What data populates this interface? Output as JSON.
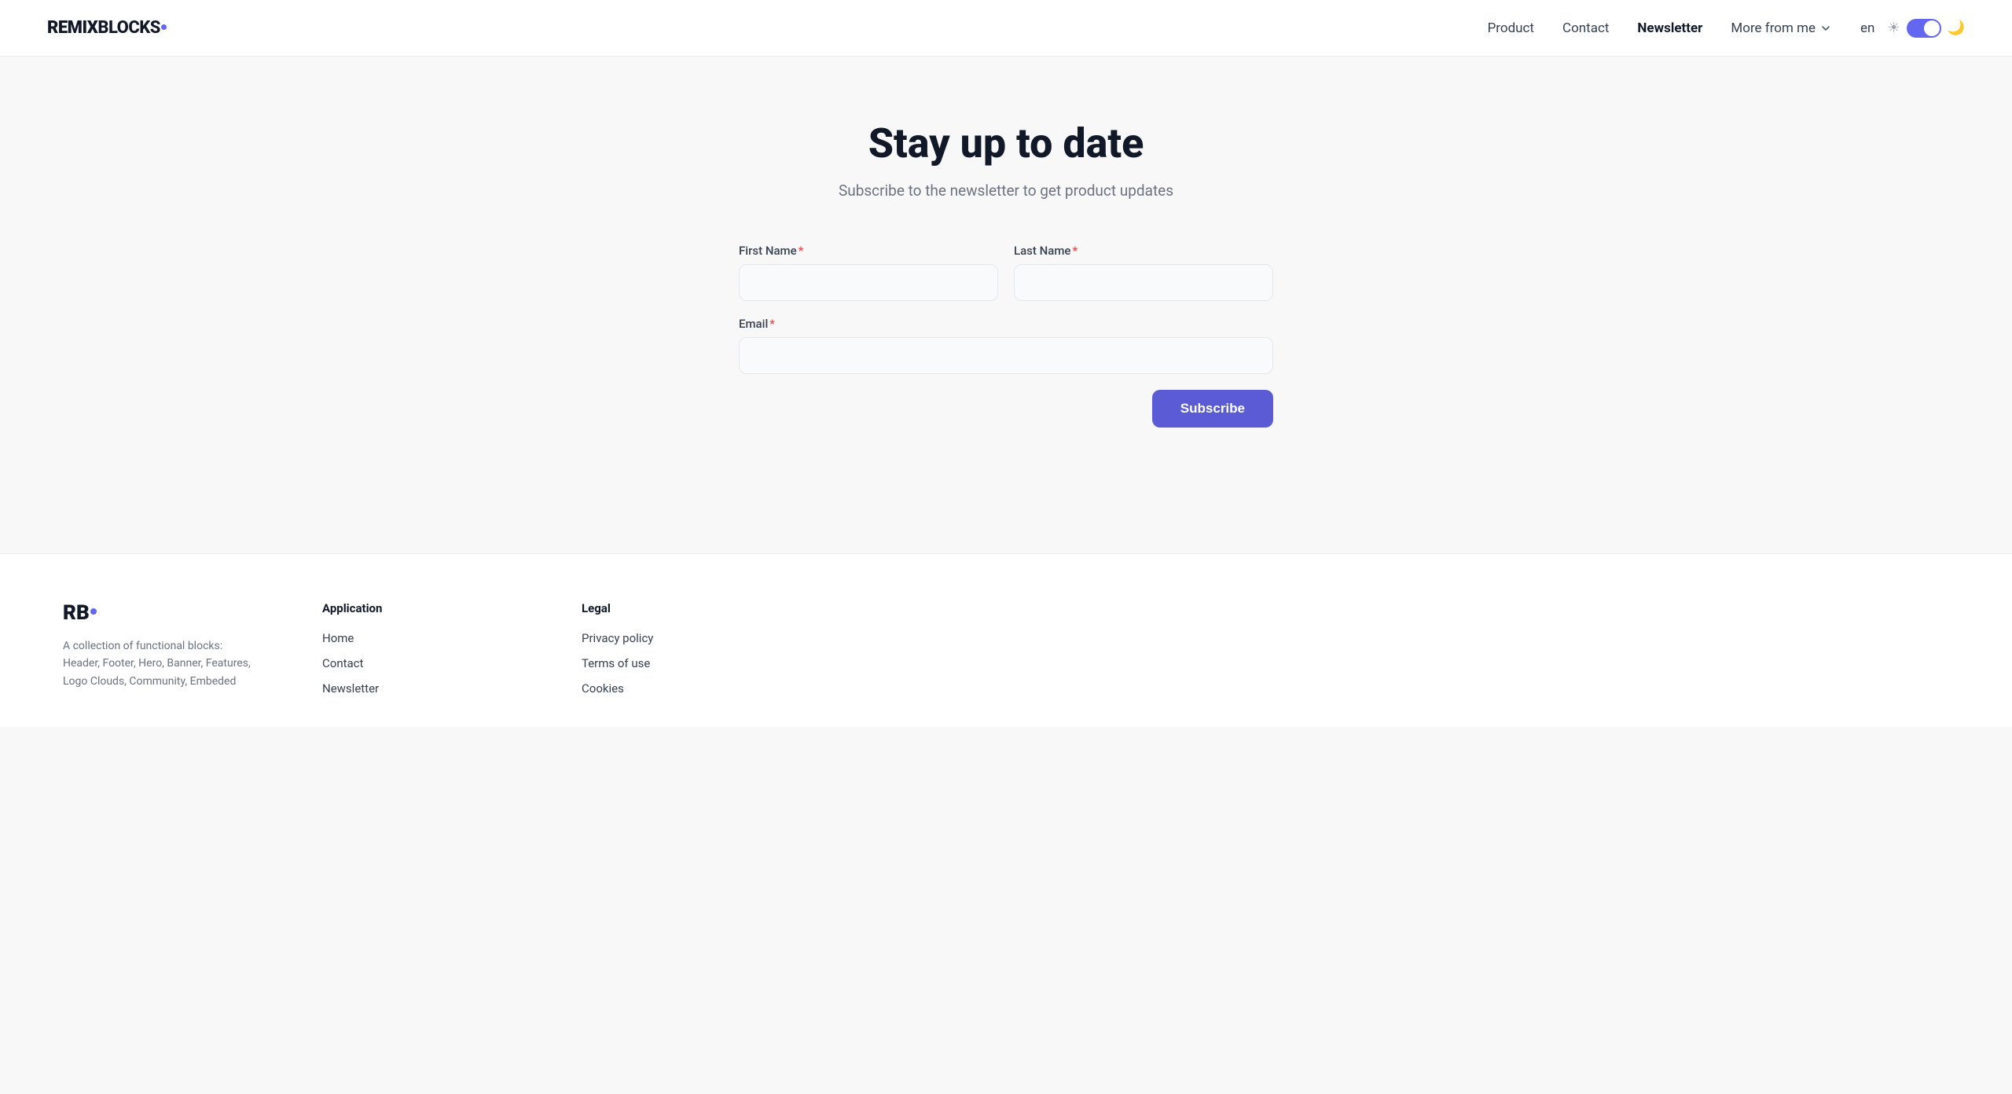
{
  "brand": {
    "name_bold": "REMIX",
    "name_rest": "BLOCKS",
    "footer_logo": "RB"
  },
  "nav": {
    "links": [
      {
        "label": "Product",
        "active": false
      },
      {
        "label": "Contact",
        "active": false
      },
      {
        "label": "Newsletter",
        "active": true
      }
    ],
    "more_label": "More from me",
    "lang": "en"
  },
  "hero": {
    "title": "Stay up to date",
    "subtitle": "Subscribe to the newsletter to get product updates"
  },
  "form": {
    "first_name_label": "First Name",
    "last_name_label": "Last Name",
    "email_label": "Email",
    "subscribe_label": "Subscribe",
    "first_name_placeholder": "",
    "last_name_placeholder": "",
    "email_placeholder": ""
  },
  "footer": {
    "brand_desc": "A collection of functional blocks: Header, Footer, Hero, Banner, Features, Logo Clouds, Community, Embeded",
    "application_title": "Application",
    "application_links": [
      {
        "label": "Home"
      },
      {
        "label": "Contact"
      },
      {
        "label": "Newsletter"
      }
    ],
    "legal_title": "Legal",
    "legal_links": [
      {
        "label": "Privacy policy"
      },
      {
        "label": "Terms of use"
      },
      {
        "label": "Cookies"
      }
    ]
  }
}
